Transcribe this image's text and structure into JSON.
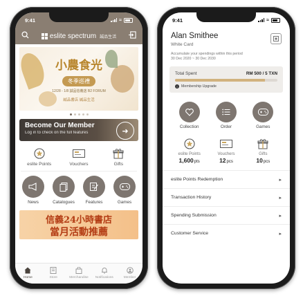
{
  "left_phone": {
    "status": {
      "time": "9:41"
    },
    "header": {
      "brand": "eslite spectrum",
      "brand_cn": "誠品生活"
    },
    "banner": {
      "title": "小農食光",
      "subtitle": "冬季巡禮",
      "date": "12/28 - 1/8  誠品信義店 B2 FORUM",
      "logos": "誠品書店   誠品生活"
    },
    "member_banner": {
      "title": "Become Our Member",
      "subtitle": "Log in to check on the full features"
    },
    "points_row": [
      {
        "label": "eslite Points",
        "icon": "points-badge-icon"
      },
      {
        "label": "Vouchers",
        "icon": "voucher-icon"
      },
      {
        "label": "Gifts",
        "icon": "gift-icon"
      }
    ],
    "circle_row": [
      {
        "label": "News",
        "icon": "megaphone-icon"
      },
      {
        "label": "Catalogues",
        "icon": "catalogue-icon"
      },
      {
        "label": "Features",
        "icon": "features-icon"
      },
      {
        "label": "Games",
        "icon": "gamepad-icon"
      }
    ],
    "promo": {
      "line1": "信義24小時書店",
      "line2": "當月活動推薦"
    },
    "tabbar": [
      {
        "label": "Home",
        "active": true
      },
      {
        "label": "Store"
      },
      {
        "label": "Merchandise"
      },
      {
        "label": "Notifications"
      },
      {
        "label": "Member"
      }
    ]
  },
  "right_phone": {
    "status": {
      "time": "9:41"
    },
    "profile": {
      "name": "Alan Smithee",
      "card": "White Card",
      "note": "Accumulate your spendings within this period",
      "period": "30 Dec 2020 ~ 30 Dec 2030"
    },
    "spent": {
      "label": "Total Spent",
      "value": "RM 500 / 5 TXN",
      "progress_fraction": 0.88,
      "upgrade": "Membership Upgrade"
    },
    "circles": [
      {
        "label": "Collection",
        "icon": "heart-icon"
      },
      {
        "label": "Order",
        "icon": "list-icon"
      },
      {
        "label": "Games",
        "icon": "gamepad-icon"
      }
    ],
    "stats": [
      {
        "label": "eslite Points",
        "value": "1,600",
        "unit": "pts"
      },
      {
        "label": "Vouchers",
        "value": "12",
        "unit": "pcs"
      },
      {
        "label": "Gifts",
        "value": "10",
        "unit": "pcs"
      }
    ],
    "menu": [
      {
        "label": "eslite Points Redemption"
      },
      {
        "label": "Transaction History"
      },
      {
        "label": "Spending Submission"
      },
      {
        "label": "Customer Service"
      }
    ]
  },
  "colors": {
    "accent_gold": "#d1b27e",
    "header_brown": "#8a7e72",
    "circle_gray": "#7e7670",
    "promo_red": "#b33c14"
  }
}
